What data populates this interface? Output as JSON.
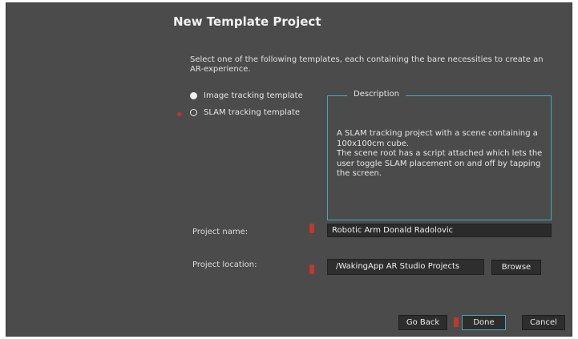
{
  "dialog": {
    "title": "New Template Project",
    "intro": "Select one of the following templates, each containing the bare necessities to create an AR-experience."
  },
  "templates": [
    {
      "label": "Image tracking template",
      "selected": false
    },
    {
      "label": "SLAM tracking template",
      "selected": true
    }
  ],
  "description": {
    "legend": "Description",
    "text": "A SLAM tracking project with a scene containing a 100x100cm cube.\nThe scene root has a script attached which lets the user toggle SLAM placement on and off by tapping the screen."
  },
  "project_name": {
    "label": "Project name:",
    "value": "Robotic Arm Donald Radolovic"
  },
  "project_location": {
    "label": "Project location:",
    "value": "/WakingApp AR Studio Projects",
    "browse_label": "Browse"
  },
  "footer": {
    "go_back_label": "Go Back",
    "done_label": "Done",
    "cancel_label": "Cancel"
  },
  "colors": {
    "dialog_bg": "#4b4b4b",
    "accent": "#4aa7b8",
    "marker": "#c0392b"
  }
}
